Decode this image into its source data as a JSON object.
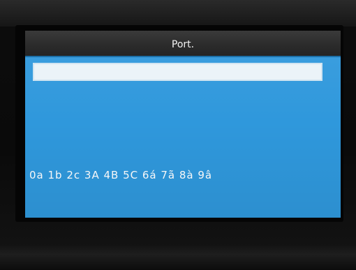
{
  "screen": {
    "title": "Port.",
    "input_value": "",
    "character_row": "0a 1b 2c 3A 4B 5C 6á 7ã 8à 9â"
  },
  "colors": {
    "screen_background": "#2f98dc",
    "title_bar": "#2b2b2b",
    "text": "#ffffff",
    "input_background": "#eaf3f8"
  }
}
